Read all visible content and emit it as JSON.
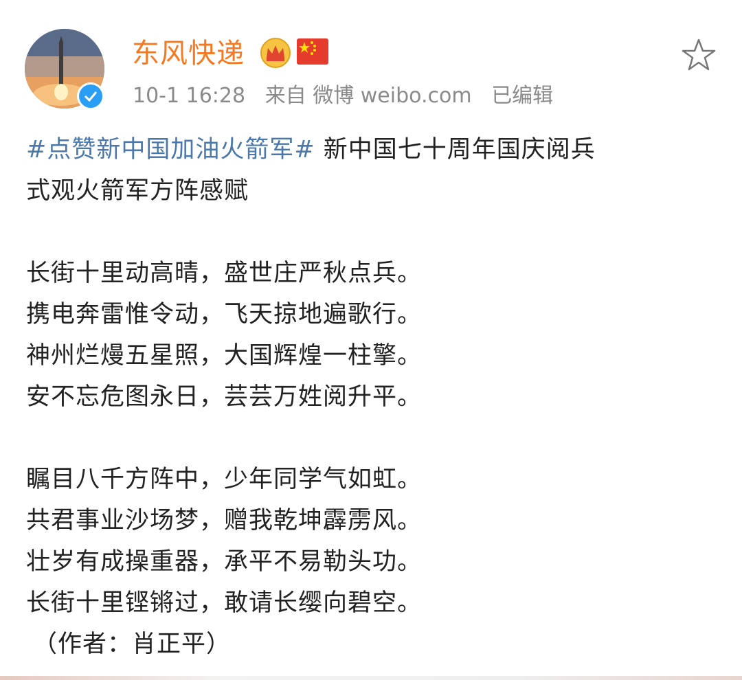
{
  "post": {
    "author": "东风快递",
    "badges": [
      "vip-crown-icon",
      "china-flag-icon"
    ],
    "verified": true,
    "time": "10-1 16:28",
    "source_prefix": "来自",
    "source": "微博 weibo.com",
    "edited": "已编辑",
    "hashtag": "#点赞新中国加油火箭军#",
    "title_line1": " 新中国七十周年国庆阅兵",
    "title_line2": "式观火箭军方阵感赋",
    "stanza1": [
      "长街十里动高晴，盛世庄严秋点兵。",
      "携电奔雷惟令动，飞天掠地遍歌行。",
      "神州烂熳五星照，大国辉煌一柱擎。",
      "安不忘危图永日，芸芸万姓阅升平。"
    ],
    "stanza2": [
      "瞩目八千方阵中，少年同学气如虹。",
      "共君事业沙场梦，赠我乾坤霹雳风。",
      "壮岁有成操重器，承平不易勒头功。",
      "长街十里铿锵过，敢请长缨向碧空。"
    ],
    "signature": "（作者：肖正平）"
  },
  "colors": {
    "username": "#f47920",
    "hashtag": "#4b78aa",
    "meta": "#8a8a8a",
    "text": "#222222",
    "verified": "#2a9df4"
  }
}
